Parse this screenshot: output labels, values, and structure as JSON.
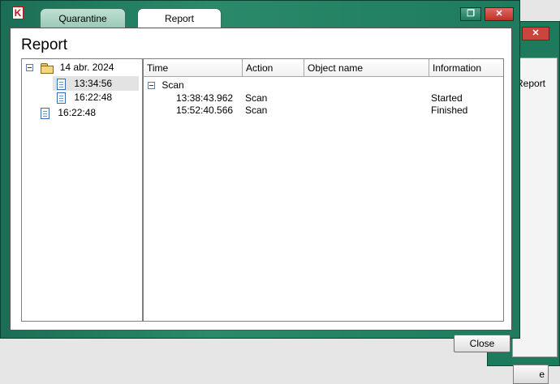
{
  "background_window": {
    "title": "Report",
    "close_glyph": "✕",
    "button_label": "e"
  },
  "window": {
    "app_icon": "K",
    "restore_glyph": "❐",
    "close_glyph": "✕",
    "tabs": [
      {
        "label": "Quarantine",
        "active": false
      },
      {
        "label": "Report",
        "active": true
      }
    ]
  },
  "panel": {
    "title": "Report"
  },
  "tree": {
    "root": {
      "label": "14 abr. 2024",
      "icon": "folder-icon",
      "expanded": true
    },
    "children": [
      {
        "label": "13:34:56",
        "icon": "document-icon",
        "selected": true
      },
      {
        "label": "16:22:48",
        "icon": "document-icon",
        "selected": false
      }
    ],
    "other": {
      "label": "16:22:48",
      "icon": "document-icon"
    }
  },
  "list": {
    "columns": [
      "Time",
      "Action",
      "Object name",
      "Information"
    ],
    "group": {
      "label": "Scan",
      "expanded": true
    },
    "rows": [
      {
        "time": "13:38:43.962",
        "action": "Scan",
        "object": "",
        "info": "Started"
      },
      {
        "time": "15:52:40.566",
        "action": "Scan",
        "object": "",
        "info": "Finished"
      }
    ]
  },
  "footer": {
    "close_label": "Close"
  },
  "colors": {
    "frame": "#1f7a5e",
    "close_red": "#bb3328"
  }
}
